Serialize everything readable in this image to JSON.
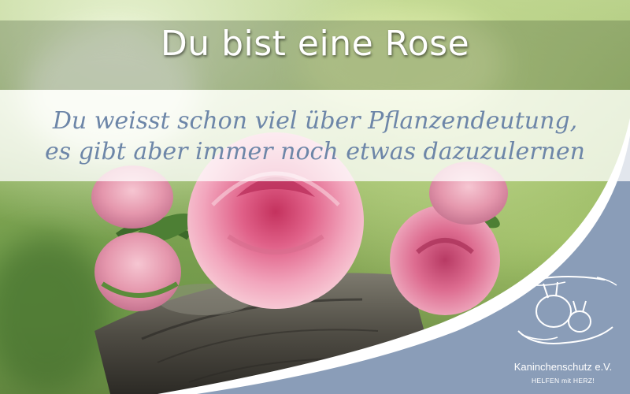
{
  "title": "Du bist eine Rose",
  "subtitle_lines": [
    "Du weisst schon viel über Pflanzendeutung,",
    "es gibt aber immer noch etwas dazuzulernen"
  ],
  "brand": {
    "name": "Kaninchenschutz e.V.",
    "tagline": "HELFEN mit HERZ!"
  },
  "logo_icon": "hands-rabbits-icon",
  "colors": {
    "subtitle_text": "#6d86a8",
    "panel_blue": "#8a9db8",
    "title_text": "#ffffff"
  }
}
